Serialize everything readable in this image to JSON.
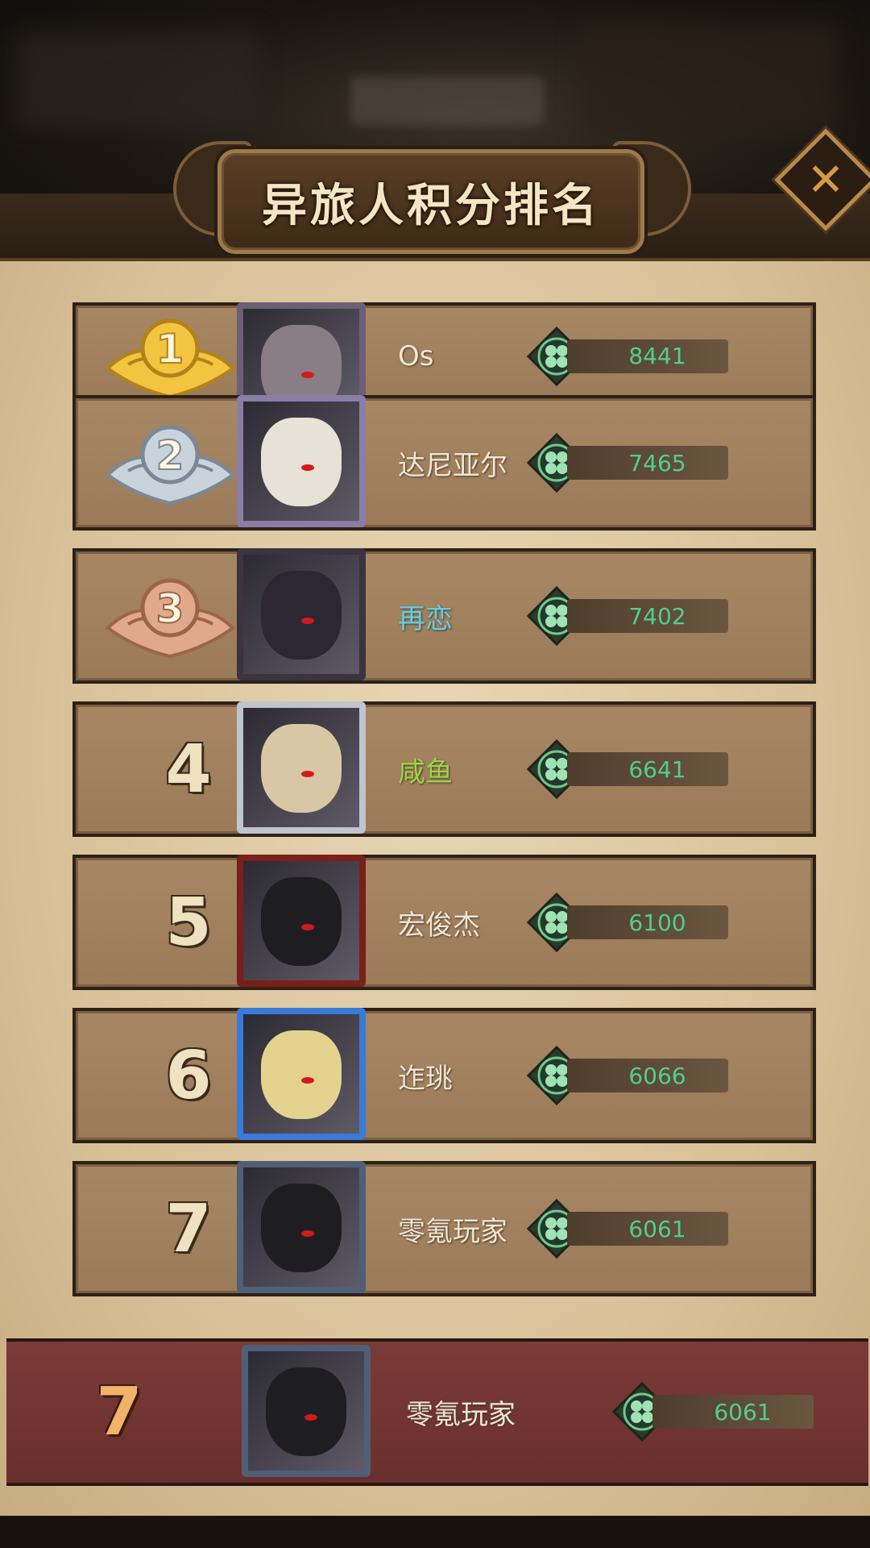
{
  "header": {
    "title": "异旅人积分排名",
    "close_icon": "close-icon"
  },
  "colors": {
    "score_text": "#4fd08a",
    "name_default": "#efe6d6",
    "name_cyan": "#5fd0ea",
    "name_green": "#9bd44a",
    "self_row": "#7b3b37"
  },
  "rankings": [
    {
      "rank": "1",
      "name": "Os",
      "score": "8441",
      "medal": "gold",
      "name_color": "default"
    },
    {
      "rank": "2",
      "name": "达尼亚尔",
      "score": "7465",
      "medal": "silver",
      "name_color": "default"
    },
    {
      "rank": "3",
      "name": "再恋",
      "score": "7402",
      "medal": "bronze",
      "name_color": "cyan"
    },
    {
      "rank": "4",
      "name": "咸鱼",
      "score": "6641",
      "medal": "none",
      "name_color": "green"
    },
    {
      "rank": "5",
      "name": "宏俊杰",
      "score": "6100",
      "medal": "none",
      "name_color": "default"
    },
    {
      "rank": "6",
      "name": "迮珧",
      "score": "6066",
      "medal": "none",
      "name_color": "default"
    },
    {
      "rank": "7",
      "name": "零氪玩家",
      "score": "6061",
      "medal": "none",
      "name_color": "default"
    }
  ],
  "self": {
    "rank": "7",
    "name": "零氪玩家",
    "score": "6061"
  },
  "icons": {
    "score": "clover-icon",
    "medal_1": "gold-medal-icon",
    "medal_2": "silver-medal-icon",
    "medal_3": "bronze-medal-icon"
  }
}
